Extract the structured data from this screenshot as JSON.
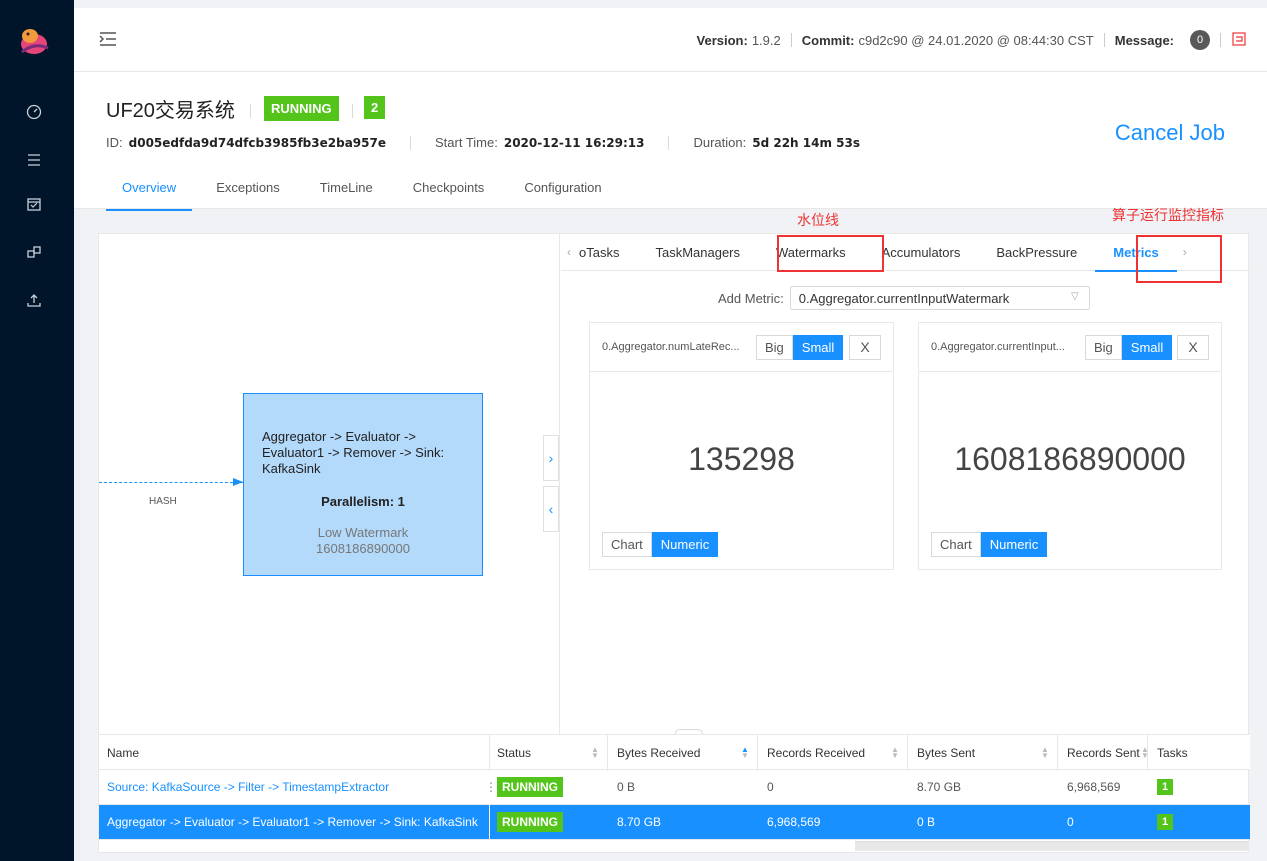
{
  "app": {
    "icons": [
      "dashboard-icon",
      "jobs-list-icon",
      "calendar-icon",
      "task-managers-icon",
      "submit-upload-icon"
    ]
  },
  "topbar": {
    "version_label": "Version:",
    "version": "1.9.2",
    "commit_label": "Commit:",
    "commit": "c9d2c90 @ 24.01.2020 @ 08:44:30 CST",
    "message_label": "Message:",
    "message_count": "0"
  },
  "job": {
    "title": "UF20交易系统",
    "status": "RUNNING",
    "running_count": "2",
    "id_label": "ID:",
    "id": "d005edfda9d74dfcb3985fb3e2ba957e",
    "start_label": "Start Time:",
    "start_time": "2020-12-11 16:29:13",
    "duration_label": "Duration:",
    "duration": "5d 22h 14m 53s",
    "cancel_label": "Cancel Job",
    "tabs": [
      "Overview",
      "Exceptions",
      "TimeLine",
      "Checkpoints",
      "Configuration"
    ],
    "active_tab": "Overview"
  },
  "annotations": {
    "watermark_note": "水位线",
    "metrics_note": "算子运行监控指标"
  },
  "graph": {
    "node_name": "Aggregator -> Evaluator -> Evaluator1 -> Remover -> Sink: KafkaSink",
    "parallelism": "Parallelism: 1",
    "watermark_label": "Low Watermark",
    "watermark_value": "1608186890000",
    "edge_label": "HASH"
  },
  "detail": {
    "subtabs": [
      "oTasks",
      "TaskManagers",
      "Watermarks",
      "Accumulators",
      "BackPressure",
      "Metrics"
    ],
    "active_subtab": "Metrics",
    "add_metric_label": "Add Metric:",
    "add_metric_value": "0.Aggregator.currentInputWatermark",
    "cards": [
      {
        "name": "0.Aggregator.numLateRec...",
        "big": "Big",
        "small": "Small",
        "close": "X",
        "value": "135298",
        "chart": "Chart",
        "numeric": "Numeric"
      },
      {
        "name": "0.Aggregator.currentInput...",
        "big": "Big",
        "small": "Small",
        "close": "X",
        "value": "1608186890000",
        "chart": "Chart",
        "numeric": "Numeric"
      }
    ]
  },
  "vertex_table": {
    "headers": [
      "Name",
      "Status",
      "Bytes Received",
      "Records Received",
      "Bytes Sent",
      "Records Sent",
      "Tasks"
    ],
    "rows": [
      {
        "name": "Source: KafkaSource -> Filter -> TimestampExtractor",
        "status": "RUNNING",
        "bytes_received": "0 B",
        "records_received": "0",
        "bytes_sent": "8.70 GB",
        "records_sent": "6,968,569",
        "tasks": "1",
        "selected": false
      },
      {
        "name": "Aggregator -> Evaluator -> Evaluator1 -> Remover -> Sink: KafkaSink",
        "status": "RUNNING",
        "bytes_received": "8.70 GB",
        "records_received": "6,968,569",
        "bytes_sent": "0 B",
        "records_sent": "0",
        "tasks": "1",
        "selected": true
      }
    ]
  },
  "colors": {
    "sidebar": "#001529",
    "accent": "#1890ff",
    "running": "#52c41a",
    "annotation": "#ee3333"
  }
}
